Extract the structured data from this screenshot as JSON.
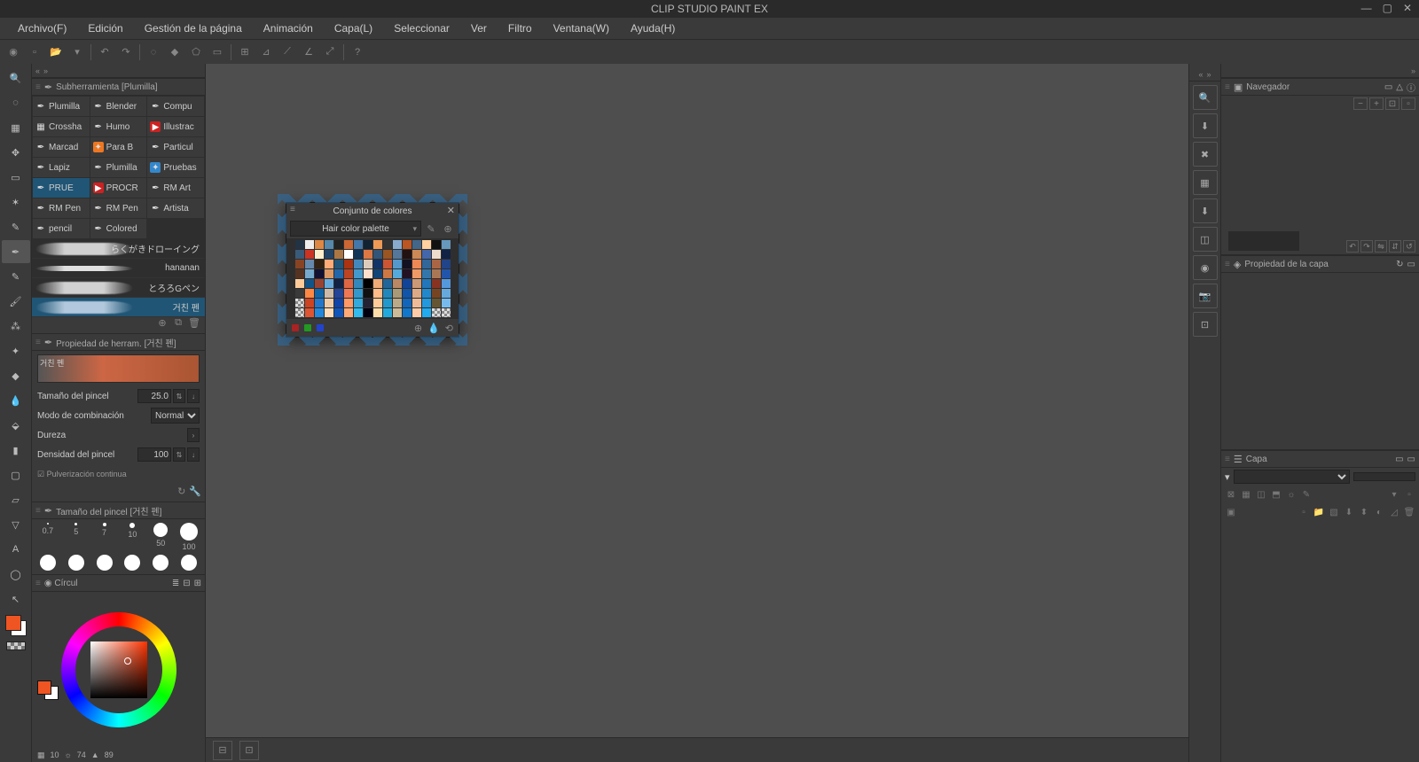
{
  "app": {
    "title": "CLIP STUDIO PAINT EX"
  },
  "menu": [
    "Archivo(F)",
    "Edición",
    "Gestión de la página",
    "Animación",
    "Capa(L)",
    "Seleccionar",
    "Ver",
    "Filtro",
    "Ventana(W)",
    "Ayuda(H)"
  ],
  "subtool_panel_title": "Subherramienta [Plumilla]",
  "subtools": [
    {
      "label": "Plumilla",
      "ico": "pen"
    },
    {
      "label": "Blender",
      "ico": "pen"
    },
    {
      "label": "Compu",
      "ico": "pen"
    },
    {
      "label": "Crossha",
      "ico": "grid"
    },
    {
      "label": "Humo",
      "ico": "pen"
    },
    {
      "label": "Illustrac",
      "ico": "red"
    },
    {
      "label": "Marcad",
      "ico": "pen"
    },
    {
      "label": "Para B",
      "ico": "orange"
    },
    {
      "label": "Particul",
      "ico": "pen"
    },
    {
      "label": "Lapiz",
      "ico": "pen"
    },
    {
      "label": "Plumilla",
      "ico": "pen"
    },
    {
      "label": "Pruebas",
      "ico": "blue"
    },
    {
      "label": "PRUE",
      "ico": "pen",
      "active": true
    },
    {
      "label": "PROCR",
      "ico": "red"
    },
    {
      "label": "RM Art",
      "ico": "pen"
    },
    {
      "label": "RM Pen",
      "ico": "pen"
    },
    {
      "label": "RM Pen",
      "ico": "pen"
    },
    {
      "label": "Artista",
      "ico": "pen"
    },
    {
      "label": "pencil",
      "ico": "pen"
    },
    {
      "label": "Colored",
      "ico": "pen"
    }
  ],
  "brush_variants": [
    {
      "label": "らくがきドローイング",
      "cls": "rough"
    },
    {
      "label": "hananan",
      "cls": "thin"
    },
    {
      "label": "とろろGペン",
      "cls": "rough"
    },
    {
      "label": "거친 펜",
      "cls": "rough",
      "selected": true
    }
  ],
  "tool_prop_title": "Propiedad de herram. [거친 펜]",
  "tool_prop_preview_label": "거친 펜",
  "props": {
    "brush_size_label": "Tamaño del pincel",
    "brush_size_value": "25.0",
    "blend_label": "Modo de combinación",
    "blend_value": "Normal",
    "hardness_label": "Dureza",
    "density_label": "Densidad del pincel",
    "density_value": "100",
    "spray_label": "Pulverización continua"
  },
  "brush_size_panel_title": "Tamaño del pincel [거친 펜]",
  "brush_sizes_top": [
    {
      "v": "0.7",
      "d": 2
    },
    {
      "v": "5",
      "d": 3
    },
    {
      "v": "7",
      "d": 4
    },
    {
      "v": "10",
      "d": 6
    },
    {
      "v": "50",
      "d": 16
    },
    {
      "v": "100",
      "d": 20
    }
  ],
  "color_tab_label": "Círcul",
  "color_readout": {
    "h": "10",
    "s": "74",
    "v": "89"
  },
  "navigator_title": "Navegador",
  "layer_prop_title": "Propiedad de la capa",
  "layer_panel_title": "Capa",
  "float": {
    "title": "Conjunto de colores",
    "select_label": "Hair color palette",
    "footer_colors": [
      "#aa2222",
      "#229922",
      "#2244cc"
    ]
  },
  "swatch_colors": [
    "#223344",
    "#eeeeee",
    "#dd8844",
    "#5588aa",
    "#222222",
    "#cc6633",
    "#4477aa",
    "#112233",
    "#ee9955",
    "#333333",
    "#88aacc",
    "#bb5522",
    "#446688",
    "#ffd0a0",
    "#111111",
    "#6699bb",
    "#3a5a7a",
    "#cc3322",
    "#ffeecc",
    "#224466",
    "#aa7744",
    "#ffffff",
    "#113355",
    "#dd7744",
    "#335577",
    "#995522",
    "#557799",
    "#221111",
    "#cc8855",
    "#4466aa",
    "#eeddcc",
    "#112244",
    "#884422",
    "#6688aa",
    "#332211",
    "#ffaa77",
    "#225577",
    "#aa3311",
    "#4488bb",
    "#ddccbb",
    "#113366",
    "#cc5533",
    "#5599cc",
    "#111122",
    "#ee8855",
    "#336699",
    "#aa6644",
    "#224488",
    "#553322",
    "#77aacc",
    "#111133",
    "#dd9966",
    "#2266aa",
    "#bb4422",
    "#4499cc",
    "#ffe0cc",
    "#114477",
    "#cc7744",
    "#55aadd",
    "#221122",
    "#ee9966",
    "#3377aa",
    "#aa7755",
    "#2255aa",
    "#ffcc99",
    "#115588",
    "#994433",
    "#66aadd",
    "#112244",
    "#dd6644",
    "#3388bb",
    "#000000",
    "#eeaa77",
    "#226699",
    "#bb8866",
    "#114499",
    "#cc9977",
    "#2277bb",
    "#883322",
    "#5599dd",
    "#3a3a3a",
    "#ff8844",
    "#1166aa",
    "#ccbbaa",
    "#224499",
    "#ee7755",
    "#3399cc",
    "#111111",
    "#ffbb88",
    "#2288bb",
    "#aa9977",
    "#1155aa",
    "#ddaa88",
    "#2288cc",
    "#774422",
    "#66aadd",
    "#checker",
    "#cc4422",
    "#2277cc",
    "#eeccaa",
    "#1144aa",
    "#ff9966",
    "#33aadd",
    "#222233",
    "#ffcc99",
    "#2299cc",
    "#bbaa88",
    "#1166bb",
    "#eebb99",
    "#2299dd",
    "#665533",
    "#77bbee",
    "#checker",
    "#dd5533",
    "#2288dd",
    "#ffddbb",
    "#1155bb",
    "#ffaa77",
    "#33bbee",
    "#000011",
    "#ffddaa",
    "#22aadd",
    "#ccbb99",
    "#1177cc",
    "#ffccaa",
    "#22aaee",
    "#checker",
    "#checker"
  ]
}
